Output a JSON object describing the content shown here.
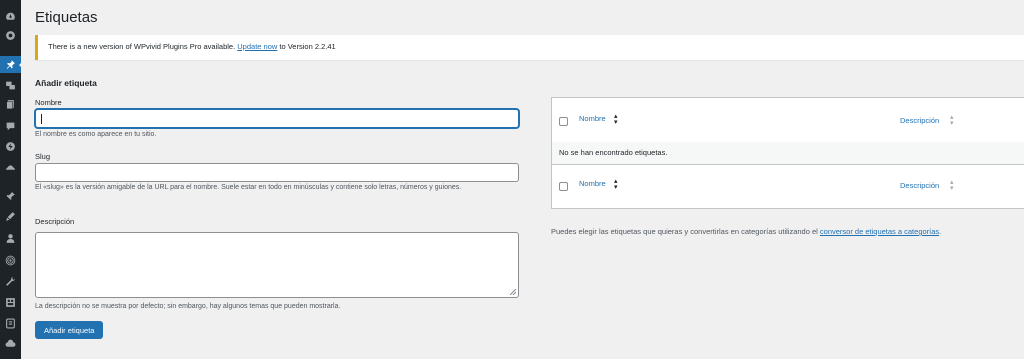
{
  "page": {
    "title": "Etiquetas"
  },
  "notice": {
    "text_before": "There is a new version of WPvivid Plugins Pro available. ",
    "link": "Update now",
    "text_after": " to Version 2.2.41"
  },
  "form": {
    "heading": "Añadir etiqueta",
    "name_label": "Nombre",
    "name_value": "",
    "name_hint": "El nombre es como aparece en tu sitio.",
    "slug_label": "Slug",
    "slug_value": "",
    "slug_hint": "El «slug» es la versión amigable de la URL para el nombre. Suele estar en todo en minúsculas y contiene solo letras, números y guiones.",
    "description_label": "Descripción",
    "description_value": "",
    "description_hint": "La descripción no se muestra por defecto; sin embargo, hay algunos temas que pueden mostrarla.",
    "submit_label": "Añadir etiqueta"
  },
  "table": {
    "columns": [
      {
        "label": "Nombre",
        "sorted": true
      },
      {
        "label": "Descripción",
        "sorted": false
      }
    ],
    "empty_message": "No se han encontrado etiquetas."
  },
  "help": {
    "text_before": "Puedes elegir las etiquetas que quieras y convertirlas en categorías utilizando el ",
    "link": "conversor de etiquetas a categorías",
    "text_after": "."
  },
  "sidebar": {
    "icons": [
      "dashboard-icon",
      "wpvivid-icon",
      "pin-icon",
      "media-icon",
      "pages-icon",
      "comments-icon",
      "plugin-brand-icon",
      "feedback-icon",
      "plugins-icon",
      "appearance-icon",
      "users-icon",
      "fingerprint-icon",
      "tools-icon",
      "settings-icon",
      "forms-icon",
      "cloud-icon"
    ],
    "active": "pin-icon"
  },
  "colors": {
    "sidebar_bg": "#1d2327",
    "accent": "#2271b1",
    "notice_border": "#dba617",
    "background": "#f0f0f1"
  }
}
